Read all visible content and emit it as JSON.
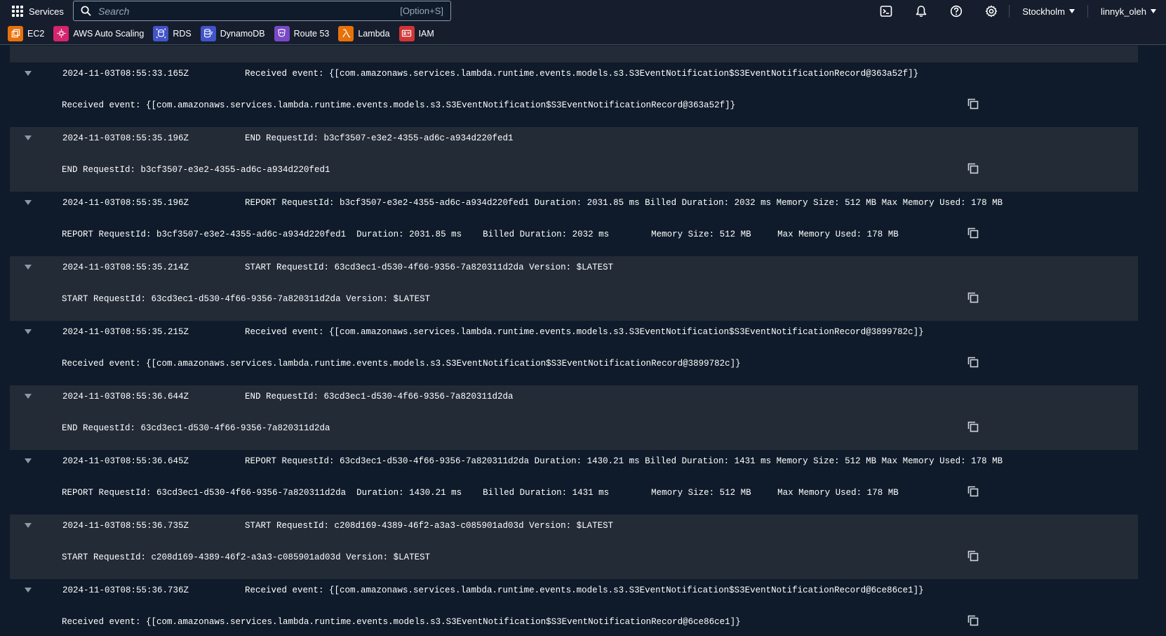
{
  "topnav": {
    "services_label": "Services",
    "search_placeholder": "Search",
    "search_shortcut": "[Option+S]",
    "icons": [
      "cloudshell-icon",
      "bell-icon",
      "help-icon",
      "gear-icon"
    ],
    "region": "Stockholm",
    "account": "linnyk_oleh"
  },
  "favorites": [
    {
      "label": "EC2",
      "icon": "ec2-icon",
      "color": "#e8710a"
    },
    {
      "label": "AWS Auto Scaling",
      "icon": "auto-scaling-icon",
      "color": "#d6246e"
    },
    {
      "label": "RDS",
      "icon": "rds-icon",
      "color": "#4154c8"
    },
    {
      "label": "DynamoDB",
      "icon": "dynamodb-icon",
      "color": "#4154c8"
    },
    {
      "label": "Route 53",
      "icon": "route53-icon",
      "color": "#7848c6"
    },
    {
      "label": "Lambda",
      "icon": "lambda-icon",
      "color": "#e8710a"
    },
    {
      "label": "IAM",
      "icon": "iam-icon",
      "color": "#d13535"
    }
  ],
  "log_events": [
    {
      "timestamp": "2024-11-03T08:55:33.165Z",
      "message": "Received event: {[com.amazonaws.services.lambda.runtime.events.models.s3.S3EventNotification$S3EventNotificationRecord@363a52f]}",
      "detail": "Received event: {[com.amazonaws.services.lambda.runtime.events.models.s3.S3EventNotification$S3EventNotificationRecord@363a52f]}"
    },
    {
      "timestamp": "2024-11-03T08:55:35.196Z",
      "message": "END RequestId: b3cf3507-e3e2-4355-ad6c-a934d220fed1",
      "detail": "END RequestId: b3cf3507-e3e2-4355-ad6c-a934d220fed1"
    },
    {
      "timestamp": "2024-11-03T08:55:35.196Z",
      "message": "REPORT RequestId: b3cf3507-e3e2-4355-ad6c-a934d220fed1 Duration: 2031.85 ms Billed Duration: 2032 ms Memory Size: 512 MB Max Memory Used: 178 MB",
      "detail": "REPORT RequestId: b3cf3507-e3e2-4355-ad6c-a934d220fed1  Duration: 2031.85 ms    Billed Duration: 2032 ms        Memory Size: 512 MB     Max Memory Used: 178 MB"
    },
    {
      "timestamp": "2024-11-03T08:55:35.214Z",
      "message": "START RequestId: 63cd3ec1-d530-4f66-9356-7a820311d2da Version: $LATEST",
      "detail": "START RequestId: 63cd3ec1-d530-4f66-9356-7a820311d2da Version: $LATEST"
    },
    {
      "timestamp": "2024-11-03T08:55:35.215Z",
      "message": "Received event: {[com.amazonaws.services.lambda.runtime.events.models.s3.S3EventNotification$S3EventNotificationRecord@3899782c]}",
      "detail": "Received event: {[com.amazonaws.services.lambda.runtime.events.models.s3.S3EventNotification$S3EventNotificationRecord@3899782c]}"
    },
    {
      "timestamp": "2024-11-03T08:55:36.644Z",
      "message": "END RequestId: 63cd3ec1-d530-4f66-9356-7a820311d2da",
      "detail": "END RequestId: 63cd3ec1-d530-4f66-9356-7a820311d2da"
    },
    {
      "timestamp": "2024-11-03T08:55:36.645Z",
      "message": "REPORT RequestId: 63cd3ec1-d530-4f66-9356-7a820311d2da Duration: 1430.21 ms Billed Duration: 1431 ms Memory Size: 512 MB Max Memory Used: 178 MB",
      "detail": "REPORT RequestId: 63cd3ec1-d530-4f66-9356-7a820311d2da  Duration: 1430.21 ms    Billed Duration: 1431 ms        Memory Size: 512 MB     Max Memory Used: 178 MB"
    },
    {
      "timestamp": "2024-11-03T08:55:36.735Z",
      "message": "START RequestId: c208d169-4389-46f2-a3a3-c085901ad03d Version: $LATEST",
      "detail": "START RequestId: c208d169-4389-46f2-a3a3-c085901ad03d Version: $LATEST"
    },
    {
      "timestamp": "2024-11-03T08:55:36.736Z",
      "message": "Received event: {[com.amazonaws.services.lambda.runtime.events.models.s3.S3EventNotification$S3EventNotificationRecord@6ce86ce1]}",
      "detail": "Received event: {[com.amazonaws.services.lambda.runtime.events.models.s3.S3EventNotification$S3EventNotificationRecord@6ce86ce1]}"
    }
  ]
}
